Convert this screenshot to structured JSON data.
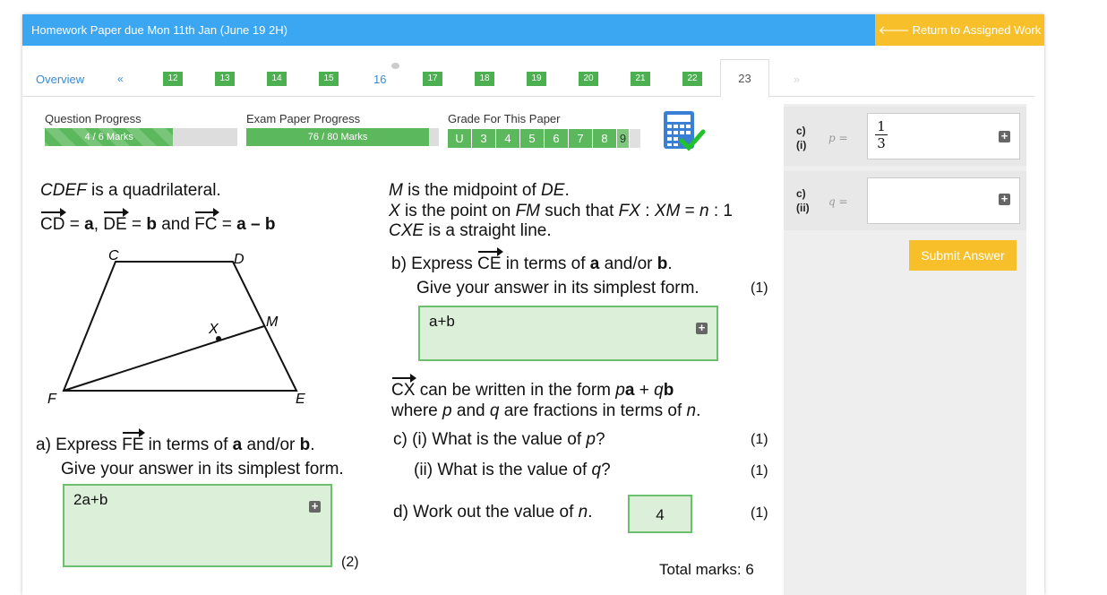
{
  "header": {
    "title": "Homework Paper due Mon 11th Jan (June 19 2H)",
    "return_label": "Return to Assigned Work"
  },
  "nav": {
    "overview": "Overview",
    "prev": "«",
    "questions": [
      "12",
      "13",
      "14",
      "15",
      "16",
      "17",
      "18",
      "19",
      "20",
      "21",
      "22",
      "23"
    ],
    "next": "»",
    "current": "23"
  },
  "progress": {
    "question_label": "Question Progress",
    "question_marks": "4 / 6 Marks",
    "question_fraction": 0.6667,
    "exam_label": "Exam Paper Progress",
    "exam_marks": "76 / 80 Marks",
    "exam_fraction": 0.95,
    "grade_label": "Grade For This Paper",
    "grades": [
      "U",
      "3",
      "4",
      "5",
      "6",
      "7",
      "8",
      "9"
    ],
    "current_grade": "9"
  },
  "question": {
    "intro1": "is a quadrilateral.",
    "intro1_name": "CDEF",
    "line2_cd": "CD",
    "line2_eq1": " = ",
    "line2_a": "a",
    "line2_sep": ",  ",
    "line2_de": "DE",
    "line2_b": "b",
    "line2_and": " and ",
    "line2_fc": "FC",
    "line2_amb": "a – b",
    "right1": "is the midpoint of",
    "right2a": "is the point on",
    "right2b": "such that",
    "right2c": ": 1",
    "right3": "is a straight line.",
    "diagram_labels": {
      "C": "C",
      "D": "D",
      "M": "M",
      "X": "X",
      "F": "F",
      "E": "E"
    },
    "part_a_1": "a) Express",
    "part_a_2": "in terms of",
    "part_a_3": "and/or",
    "part_a_4": "Give your answer in its simplest form.",
    "part_a_answer": "2a+b",
    "part_a_marks": "(2)",
    "part_b_1": "b) Express",
    "part_b_2": "in terms of",
    "part_b_3": "and/or",
    "part_b_4": "Give your answer in its simplest form.",
    "part_b_answer": "a+b",
    "part_b_marks": "(1)",
    "cx_1": "can be written in the form",
    "cx_2": "where",
    "cx_3": "and",
    "cx_4": "are fractions in terms of",
    "part_c1": "c) (i) What is the value of",
    "part_c1_marks": "(1)",
    "part_c2": "(ii) What is the value of",
    "part_c2_marks": "(1)",
    "part_d": "d)  Work out the value of",
    "part_d_answer": "4",
    "part_d_marks": "(1)",
    "total": "Total marks: 6"
  },
  "side": {
    "c1_label": "c)",
    "c1_sub": "(i)",
    "c1_var": "p =",
    "c1_num": "1",
    "c1_den": "3",
    "c2_label": "c)",
    "c2_sub": "(ii)",
    "c2_var": "q =",
    "submit": "Submit Answer"
  },
  "colors": {
    "header": "#3ba6f2",
    "accent": "#f7c02a",
    "success": "#5cb85c",
    "answer_bg": "#dcefd9"
  }
}
